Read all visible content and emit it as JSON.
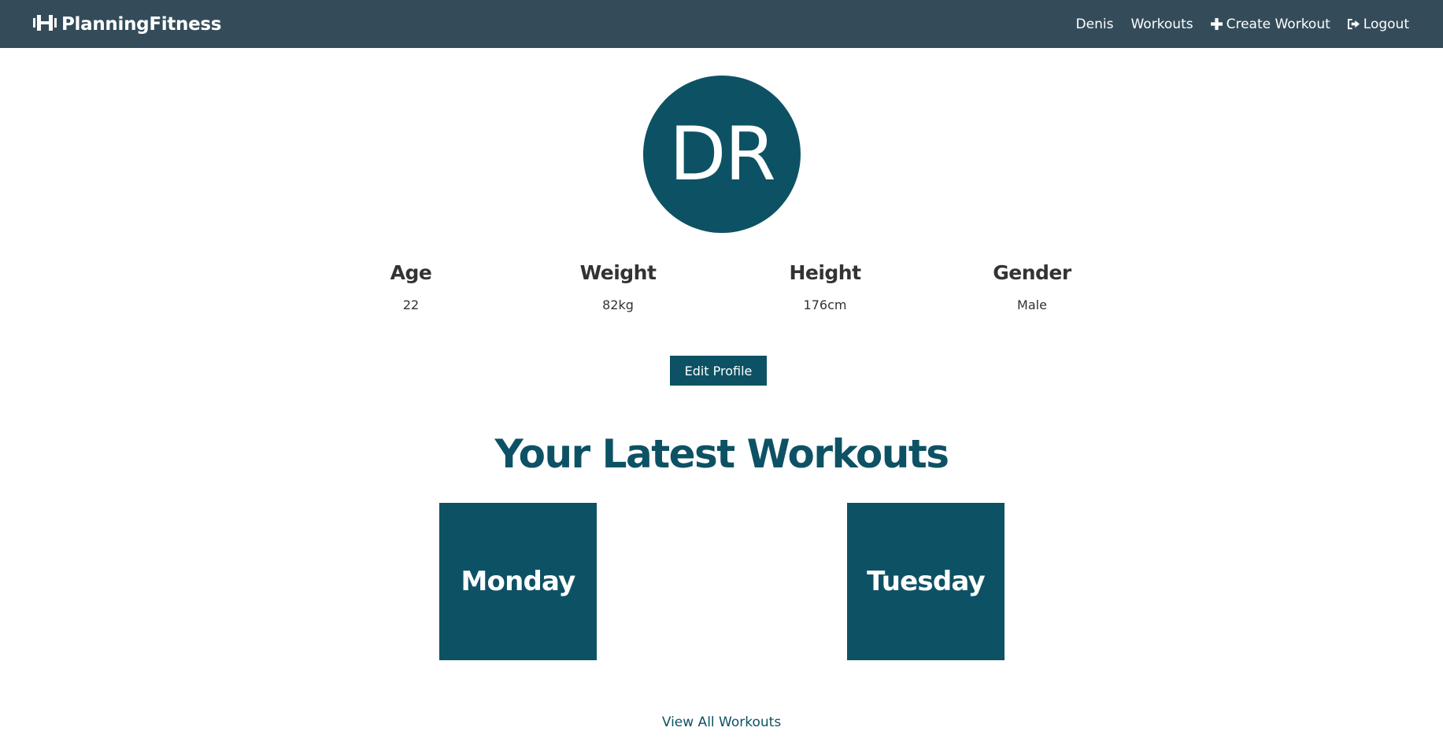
{
  "navbar": {
    "brand": "PlanningFitness",
    "links": [
      {
        "label": "Denis",
        "icon": ""
      },
      {
        "label": "Workouts",
        "icon": ""
      },
      {
        "label": "Create Workout",
        "icon": "plus-icon"
      },
      {
        "label": "Logout",
        "icon": "sign-out-icon"
      }
    ],
    "background": "#344c5a"
  },
  "profile": {
    "initials": "DR",
    "stats": [
      {
        "label": "Age",
        "value": "22"
      },
      {
        "label": "Weight",
        "value": "82kg"
      },
      {
        "label": "Height",
        "value": "176cm"
      },
      {
        "label": "Gender",
        "value": "Male"
      }
    ],
    "edit_label": "Edit Profile"
  },
  "workouts": {
    "title": "Your Latest Workouts",
    "cards": [
      {
        "label": "Monday"
      },
      {
        "label": "Tuesday"
      }
    ],
    "view_all_label": "View All Workouts"
  },
  "colors": {
    "accent": "#0d5264",
    "text": "#333333"
  }
}
